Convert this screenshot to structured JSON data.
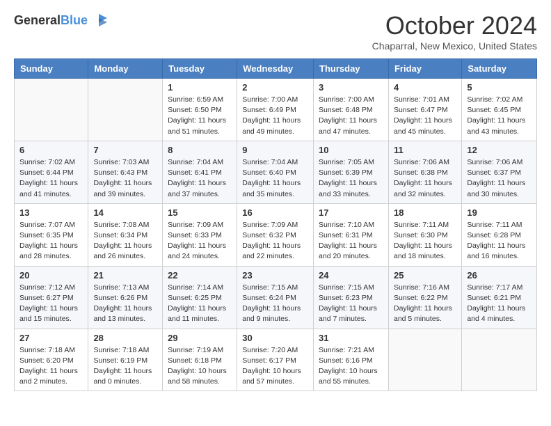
{
  "header": {
    "logo_line1": "General",
    "logo_line2": "Blue",
    "month_title": "October 2024",
    "subtitle": "Chaparral, New Mexico, United States"
  },
  "days_of_week": [
    "Sunday",
    "Monday",
    "Tuesday",
    "Wednesday",
    "Thursday",
    "Friday",
    "Saturday"
  ],
  "weeks": [
    [
      {
        "day": "",
        "sunrise": "",
        "sunset": "",
        "daylight": ""
      },
      {
        "day": "",
        "sunrise": "",
        "sunset": "",
        "daylight": ""
      },
      {
        "day": "1",
        "sunrise": "Sunrise: 6:59 AM",
        "sunset": "Sunset: 6:50 PM",
        "daylight": "Daylight: 11 hours and 51 minutes."
      },
      {
        "day": "2",
        "sunrise": "Sunrise: 7:00 AM",
        "sunset": "Sunset: 6:49 PM",
        "daylight": "Daylight: 11 hours and 49 minutes."
      },
      {
        "day": "3",
        "sunrise": "Sunrise: 7:00 AM",
        "sunset": "Sunset: 6:48 PM",
        "daylight": "Daylight: 11 hours and 47 minutes."
      },
      {
        "day": "4",
        "sunrise": "Sunrise: 7:01 AM",
        "sunset": "Sunset: 6:47 PM",
        "daylight": "Daylight: 11 hours and 45 minutes."
      },
      {
        "day": "5",
        "sunrise": "Sunrise: 7:02 AM",
        "sunset": "Sunset: 6:45 PM",
        "daylight": "Daylight: 11 hours and 43 minutes."
      }
    ],
    [
      {
        "day": "6",
        "sunrise": "Sunrise: 7:02 AM",
        "sunset": "Sunset: 6:44 PM",
        "daylight": "Daylight: 11 hours and 41 minutes."
      },
      {
        "day": "7",
        "sunrise": "Sunrise: 7:03 AM",
        "sunset": "Sunset: 6:43 PM",
        "daylight": "Daylight: 11 hours and 39 minutes."
      },
      {
        "day": "8",
        "sunrise": "Sunrise: 7:04 AM",
        "sunset": "Sunset: 6:41 PM",
        "daylight": "Daylight: 11 hours and 37 minutes."
      },
      {
        "day": "9",
        "sunrise": "Sunrise: 7:04 AM",
        "sunset": "Sunset: 6:40 PM",
        "daylight": "Daylight: 11 hours and 35 minutes."
      },
      {
        "day": "10",
        "sunrise": "Sunrise: 7:05 AM",
        "sunset": "Sunset: 6:39 PM",
        "daylight": "Daylight: 11 hours and 33 minutes."
      },
      {
        "day": "11",
        "sunrise": "Sunrise: 7:06 AM",
        "sunset": "Sunset: 6:38 PM",
        "daylight": "Daylight: 11 hours and 32 minutes."
      },
      {
        "day": "12",
        "sunrise": "Sunrise: 7:06 AM",
        "sunset": "Sunset: 6:37 PM",
        "daylight": "Daylight: 11 hours and 30 minutes."
      }
    ],
    [
      {
        "day": "13",
        "sunrise": "Sunrise: 7:07 AM",
        "sunset": "Sunset: 6:35 PM",
        "daylight": "Daylight: 11 hours and 28 minutes."
      },
      {
        "day": "14",
        "sunrise": "Sunrise: 7:08 AM",
        "sunset": "Sunset: 6:34 PM",
        "daylight": "Daylight: 11 hours and 26 minutes."
      },
      {
        "day": "15",
        "sunrise": "Sunrise: 7:09 AM",
        "sunset": "Sunset: 6:33 PM",
        "daylight": "Daylight: 11 hours and 24 minutes."
      },
      {
        "day": "16",
        "sunrise": "Sunrise: 7:09 AM",
        "sunset": "Sunset: 6:32 PM",
        "daylight": "Daylight: 11 hours and 22 minutes."
      },
      {
        "day": "17",
        "sunrise": "Sunrise: 7:10 AM",
        "sunset": "Sunset: 6:31 PM",
        "daylight": "Daylight: 11 hours and 20 minutes."
      },
      {
        "day": "18",
        "sunrise": "Sunrise: 7:11 AM",
        "sunset": "Sunset: 6:30 PM",
        "daylight": "Daylight: 11 hours and 18 minutes."
      },
      {
        "day": "19",
        "sunrise": "Sunrise: 7:11 AM",
        "sunset": "Sunset: 6:28 PM",
        "daylight": "Daylight: 11 hours and 16 minutes."
      }
    ],
    [
      {
        "day": "20",
        "sunrise": "Sunrise: 7:12 AM",
        "sunset": "Sunset: 6:27 PM",
        "daylight": "Daylight: 11 hours and 15 minutes."
      },
      {
        "day": "21",
        "sunrise": "Sunrise: 7:13 AM",
        "sunset": "Sunset: 6:26 PM",
        "daylight": "Daylight: 11 hours and 13 minutes."
      },
      {
        "day": "22",
        "sunrise": "Sunrise: 7:14 AM",
        "sunset": "Sunset: 6:25 PM",
        "daylight": "Daylight: 11 hours and 11 minutes."
      },
      {
        "day": "23",
        "sunrise": "Sunrise: 7:15 AM",
        "sunset": "Sunset: 6:24 PM",
        "daylight": "Daylight: 11 hours and 9 minutes."
      },
      {
        "day": "24",
        "sunrise": "Sunrise: 7:15 AM",
        "sunset": "Sunset: 6:23 PM",
        "daylight": "Daylight: 11 hours and 7 minutes."
      },
      {
        "day": "25",
        "sunrise": "Sunrise: 7:16 AM",
        "sunset": "Sunset: 6:22 PM",
        "daylight": "Daylight: 11 hours and 5 minutes."
      },
      {
        "day": "26",
        "sunrise": "Sunrise: 7:17 AM",
        "sunset": "Sunset: 6:21 PM",
        "daylight": "Daylight: 11 hours and 4 minutes."
      }
    ],
    [
      {
        "day": "27",
        "sunrise": "Sunrise: 7:18 AM",
        "sunset": "Sunset: 6:20 PM",
        "daylight": "Daylight: 11 hours and 2 minutes."
      },
      {
        "day": "28",
        "sunrise": "Sunrise: 7:18 AM",
        "sunset": "Sunset: 6:19 PM",
        "daylight": "Daylight: 11 hours and 0 minutes."
      },
      {
        "day": "29",
        "sunrise": "Sunrise: 7:19 AM",
        "sunset": "Sunset: 6:18 PM",
        "daylight": "Daylight: 10 hours and 58 minutes."
      },
      {
        "day": "30",
        "sunrise": "Sunrise: 7:20 AM",
        "sunset": "Sunset: 6:17 PM",
        "daylight": "Daylight: 10 hours and 57 minutes."
      },
      {
        "day": "31",
        "sunrise": "Sunrise: 7:21 AM",
        "sunset": "Sunset: 6:16 PM",
        "daylight": "Daylight: 10 hours and 55 minutes."
      },
      {
        "day": "",
        "sunrise": "",
        "sunset": "",
        "daylight": ""
      },
      {
        "day": "",
        "sunrise": "",
        "sunset": "",
        "daylight": ""
      }
    ]
  ]
}
